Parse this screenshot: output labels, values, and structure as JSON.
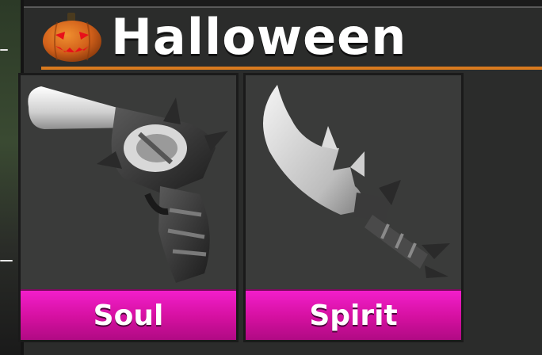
{
  "section": {
    "title": "Halloween",
    "icon": "pumpkin-icon",
    "accent_color": "#d97a1e"
  },
  "items": [
    {
      "name": "Soul",
      "icon": "revolver-gun-icon",
      "rarity_color": "#e01ab8"
    },
    {
      "name": "Spirit",
      "icon": "curved-knife-icon",
      "rarity_color": "#e01ab8"
    }
  ]
}
